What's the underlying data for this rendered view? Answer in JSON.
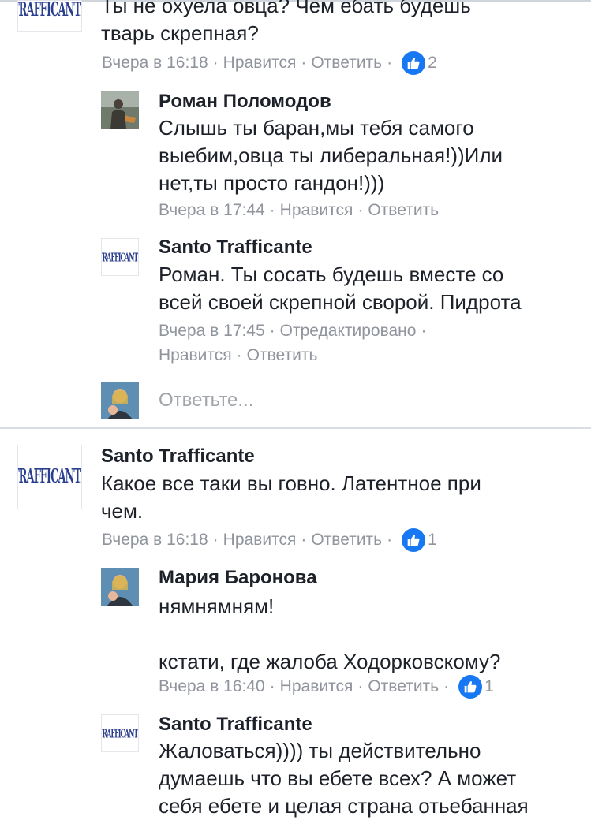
{
  "comments": [
    {
      "text": "Ты не охуела овца? Чем ебать будешь\nтварь скрепная?",
      "time": "Вчера в 16:18",
      "like": "Нравится",
      "reply": "Ответить",
      "like_count": "2"
    },
    {
      "author": "Роман Поломодов",
      "text": "Слышь ты баран,мы тебя самого\nвыебим,овца ты либеральная!))Или\nнет,ты просто гандон!)))",
      "time": "Вчера в 17:44",
      "like": "Нравится",
      "reply": "Ответить"
    },
    {
      "author": "Santo Trafficante",
      "text": "Роман. Ты сосать будешь вместе со\nвсей своей скрепной сворой. Пидрота",
      "time": "Вчера в 17:45",
      "edited": "Отредактировано",
      "like": "Нравится",
      "reply": "Ответить"
    },
    {
      "author": "Santo Trafficante",
      "text": "Какое все таки вы говно. Латентное при\nчем.",
      "time": "Вчера в 16:18",
      "like": "Нравится",
      "reply": "Ответить",
      "like_count": "1"
    },
    {
      "author": "Мария Баронова",
      "text": "нямнямням!\n\nкстати, где жалоба Ходорковскому?",
      "time": "Вчера в 16:40",
      "like": "Нравится",
      "reply": "Ответить",
      "like_count": "1"
    },
    {
      "author": "Santo Trafficante",
      "text": "Жаловаться))))  ты действительно\nдумаешь что вы ебете всех? А может\nсебя ебете и целая страна отьебанная"
    }
  ],
  "reply_box": {
    "placeholder": "Ответьте..."
  },
  "logo_text": "TRAFFICANTE",
  "colors": {
    "like_blue": "#1877f2",
    "meta_gray": "#90949c",
    "logo_blue": "#2a3f8f"
  },
  "icons": {
    "like": "thumbs-up-icon"
  }
}
